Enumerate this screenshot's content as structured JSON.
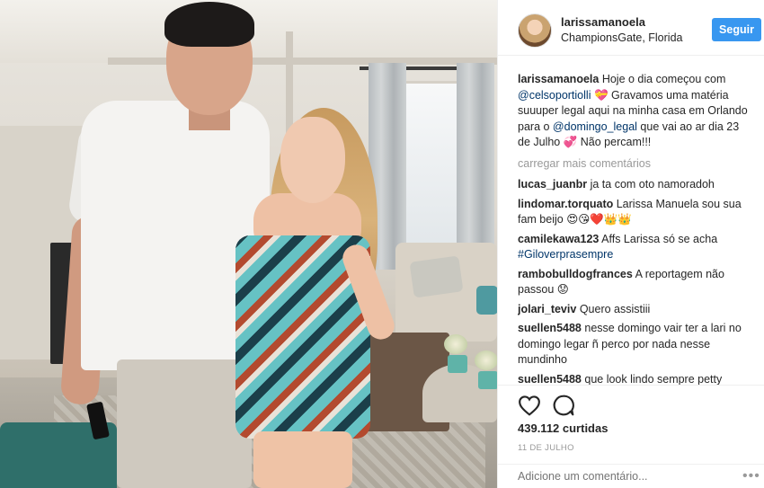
{
  "post": {
    "username": "larissamanoela",
    "location": "ChampionsGate, Florida",
    "follow_label": "Seguir"
  },
  "caption": {
    "username": "larissamanoela",
    "text_1": "Hoje o dia começou com ",
    "mention_1": "@celsoportiolli",
    "text_2": " 💝 Gravamos uma matéria suuuper legal aqui na minha casa em Orlando para o ",
    "mention_2": "@domingo_legal",
    "text_3": " que vai ao ar dia 23 de Julho 💞 Não percam!!!"
  },
  "load_more": "carregar mais comentários",
  "comments": [
    {
      "user": "lucas_juanbr",
      "text": "ja ta com oto namoradoh"
    },
    {
      "user": "lindomar.torquato",
      "text": "Larissa Manuela sou sua fam beijo 😍😘❤️👑👑"
    },
    {
      "user": "camilekawa123",
      "text": "Affs Larissa só se acha ",
      "mention": "#Giloverprasempre"
    },
    {
      "user": "rambobulldogfrances",
      "text": "A reportagem não passou 😟"
    },
    {
      "user": "jolari_teviv",
      "text": "Quero assistiii"
    },
    {
      "user": "suellen5488",
      "text": "nesse domingo vair ter a lari no domingo legar ñ perco por nada nesse mundinho"
    },
    {
      "user": "suellen5488",
      "text": "que look lindo sempre petty"
    }
  ],
  "likes": "439.112 curtidas",
  "date": "11 DE JULHO",
  "add_comment_placeholder": "Adicione um comentário...",
  "more_options": "•••",
  "icons": {
    "like": "heart-icon",
    "comment": "comment-icon",
    "options": "more-options-icon"
  },
  "colors": {
    "accent": "#3897f0",
    "mention": "#003569",
    "muted": "#999999"
  }
}
